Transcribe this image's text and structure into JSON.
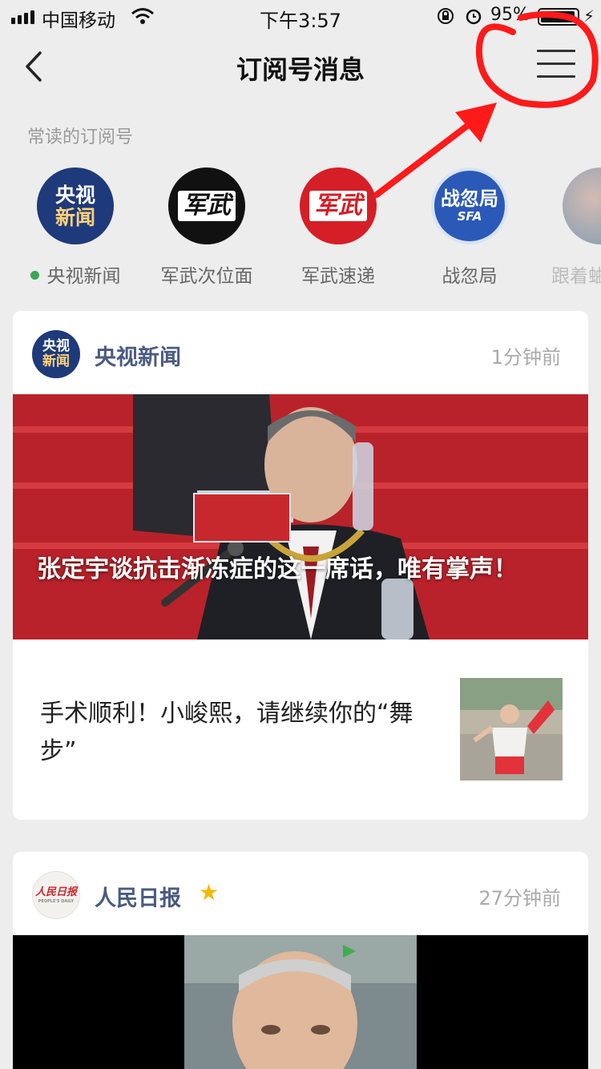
{
  "status_bar": {
    "carrier": "中国移动",
    "time": "下午3:57",
    "battery_text": "95%",
    "battery_level": 0.95
  },
  "nav": {
    "title": "订阅号消息"
  },
  "frequent": {
    "label": "常读的订阅号",
    "items": [
      {
        "label": "央视新闻",
        "avatar_line1": "央视",
        "avatar_line2": "新闻",
        "has_update": true
      },
      {
        "label": "军武次位面",
        "avatar_text": "军武"
      },
      {
        "label": "军武速递",
        "avatar_text": "军武"
      },
      {
        "label": "战忽局",
        "avatar_text": "战忽局",
        "avatar_sub": "SFA"
      },
      {
        "label": "跟着蛐"
      }
    ]
  },
  "cards": [
    {
      "source": "央视新闻",
      "avatar_line1": "央视",
      "avatar_line2": "新闻",
      "time_ago": "1分钟前",
      "hero_title": "张定宇谈抗击渐冻症的这一席话，唯有掌声！",
      "items": [
        {
          "title": "手术顺利！小峻熙，请继续你的“舞步”"
        }
      ]
    },
    {
      "source": "人民日报",
      "avatar_text": "人民日报",
      "avatar_sub": "PEOPLE'S DAILY",
      "time_ago": "27分钟前",
      "starred": true
    }
  ],
  "colors": {
    "background": "#ededed",
    "source_name": "#4a5b82",
    "cctv_blue": "#1e3a7a",
    "junwu_red": "#d61e26",
    "star": "#f5b800",
    "unread_dot": "#3aa757"
  }
}
